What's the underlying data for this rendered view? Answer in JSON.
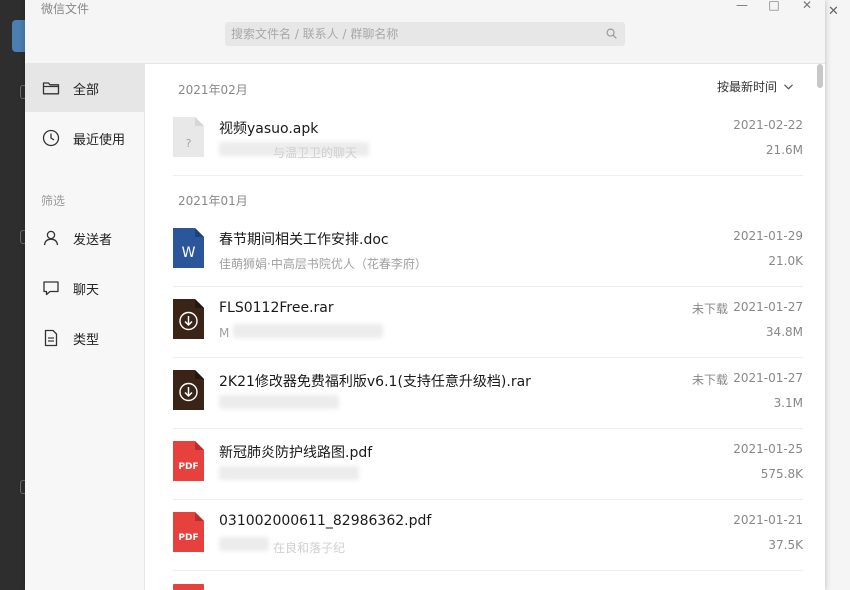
{
  "window": {
    "title": "微信文件",
    "search_placeholder": "搜索文件名 / 联系人 / 群聊名称",
    "minimize_symbol": "—",
    "maximize_symbol": "□",
    "close_symbol": "✕"
  },
  "background": {
    "close_symbol": "✕"
  },
  "sidebar": {
    "items": [
      {
        "label": "全部",
        "icon": "folder-icon"
      },
      {
        "label": "最近使用",
        "icon": "clock-icon"
      }
    ],
    "filter_label": "筛选",
    "filter_items": [
      {
        "label": "发送者",
        "icon": "person-icon"
      },
      {
        "label": "聊天",
        "icon": "chat-icon"
      },
      {
        "label": "类型",
        "icon": "document-icon"
      }
    ]
  },
  "content": {
    "sort_label": "按最新时间",
    "groups": [
      {
        "month": "2021年02月"
      },
      {
        "month": "2021年01月"
      }
    ],
    "files": [
      {
        "name": "视频yasuo.apk",
        "subtitle": "与温卫卫的聊天",
        "date": "2021-02-22",
        "size": "21.6M",
        "status": "",
        "type": "unknown",
        "type_glyph": "?"
      },
      {
        "name": "春节期间相关工作安排.doc",
        "subtitle": "佳萌狮娟·中高层书院优人（花春李府）",
        "date": "2021-01-29",
        "size": "21.0K",
        "status": "",
        "type": "word",
        "type_glyph": "W"
      },
      {
        "name": "FLS0112Free.rar",
        "subtitle": "M",
        "date": "2021-01-27",
        "size": "34.8M",
        "status": "未下载",
        "type": "archive"
      },
      {
        "name": "2K21修改器免费福利版v6.1(支持任意升级档).rar",
        "subtitle": "",
        "date": "2021-01-27",
        "size": "3.1M",
        "status": "未下载",
        "type": "archive"
      },
      {
        "name": "新冠肺炎防护线路图.pdf",
        "subtitle": "",
        "date": "2021-01-25",
        "size": "575.8K",
        "status": "",
        "type": "pdf",
        "type_glyph": "PDF"
      },
      {
        "name": "031002000611_82986362.pdf",
        "subtitle": "在良和落子纪",
        "date": "2021-01-21",
        "size": "37.5K",
        "status": "",
        "type": "pdf",
        "type_glyph": "PDF"
      }
    ]
  },
  "colors": {
    "word": "#2b579a",
    "archive": "#3a2418",
    "pdf": "#e6413d",
    "unknown": "#e8e8e8"
  }
}
